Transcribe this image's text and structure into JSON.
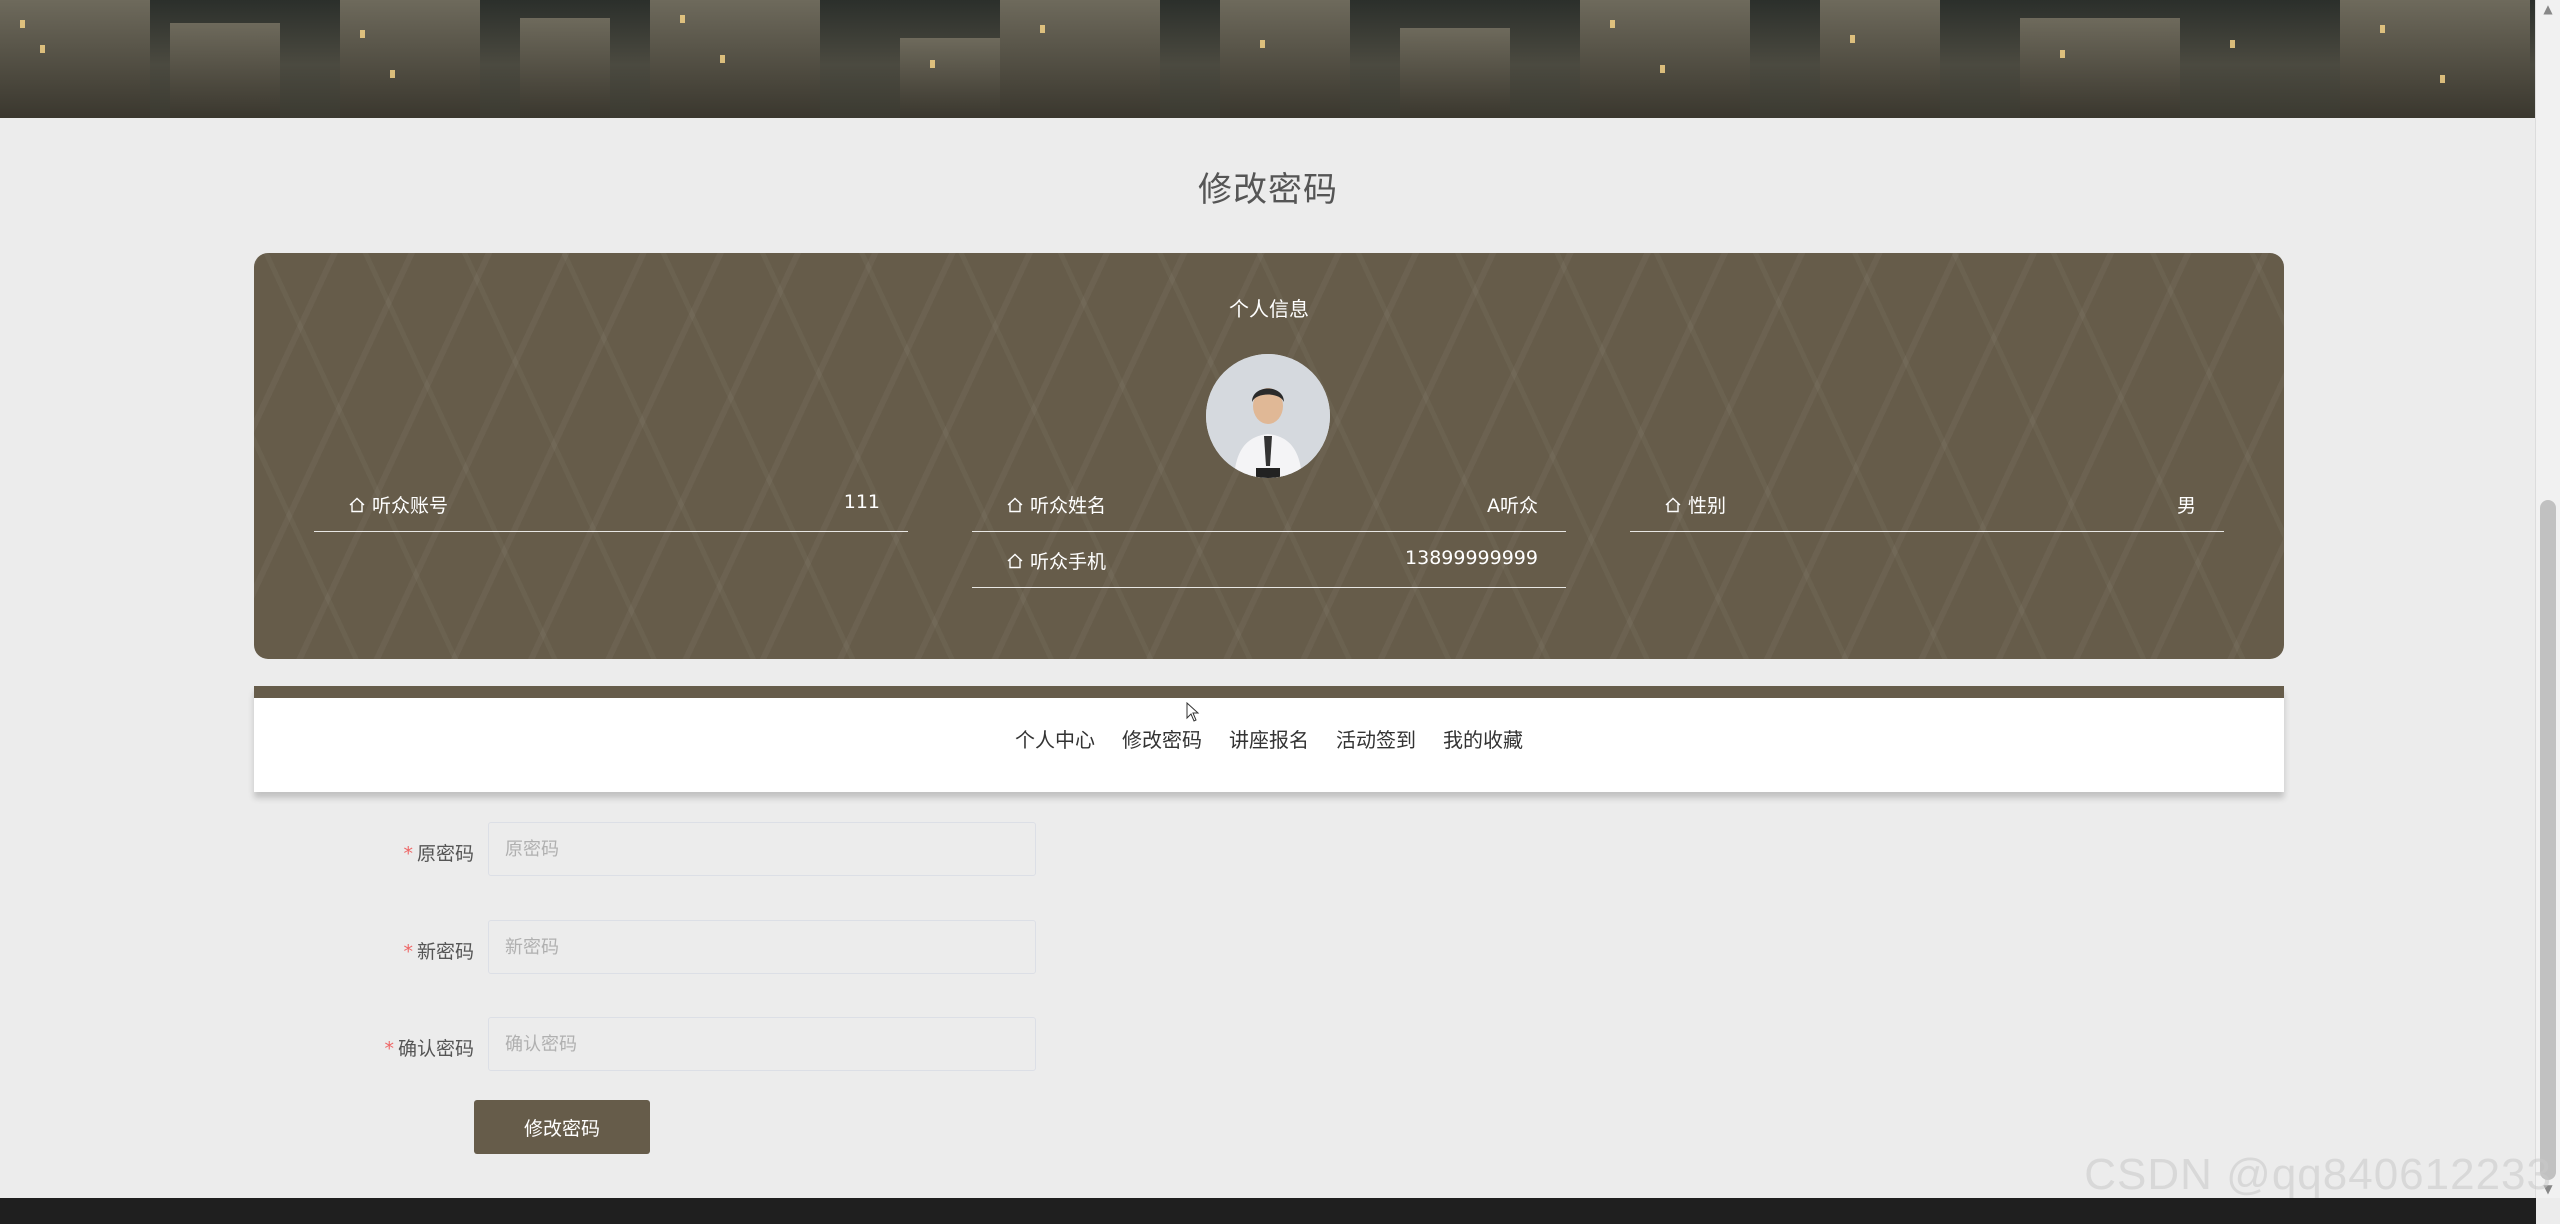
{
  "page": {
    "title": "修改密码"
  },
  "profile": {
    "heading": "个人信息",
    "fields": [
      {
        "label": "听众账号",
        "value": "111",
        "icon": "home-icon"
      },
      {
        "label": "听众姓名",
        "value": "A听众",
        "icon": "home-icon"
      },
      {
        "label": "性别",
        "value": "男",
        "icon": "home-icon"
      },
      {
        "label": "听众手机",
        "value": "13899999999",
        "icon": "home-icon"
      }
    ]
  },
  "tabs": [
    {
      "label": "个人中心"
    },
    {
      "label": "修改密码"
    },
    {
      "label": "讲座报名"
    },
    {
      "label": "活动签到"
    },
    {
      "label": "我的收藏"
    }
  ],
  "form": {
    "old_password": {
      "label": "原密码",
      "placeholder": "原密码",
      "required": true
    },
    "new_password": {
      "label": "新密码",
      "placeholder": "新密码",
      "required": true
    },
    "confirm_password": {
      "label": "确认密码",
      "placeholder": "确认密码",
      "required": true
    },
    "submit_label": "修改密码"
  },
  "watermark": "CSDN @qq840612233",
  "colors": {
    "accent": "#665c4a",
    "background": "#ececec",
    "required": "#e66666"
  }
}
